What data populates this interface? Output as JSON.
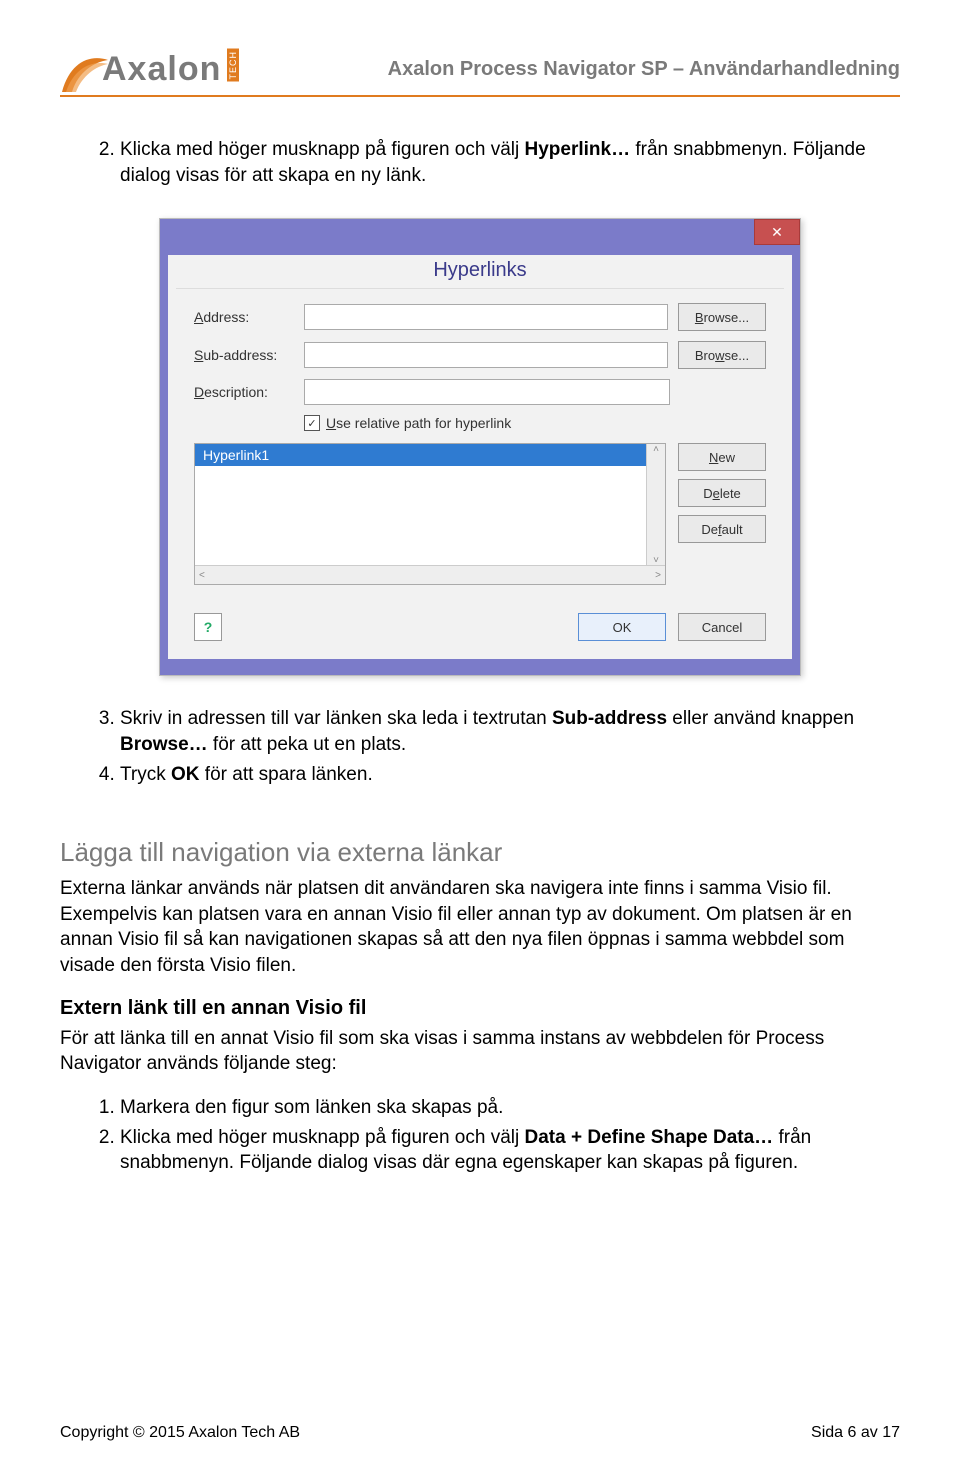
{
  "header": {
    "logo_text": "Axalon",
    "logo_tag": "TECH",
    "doc_title": "Axalon Process Navigator SP – Användarhandledning"
  },
  "list1": {
    "start": 2,
    "items": [
      {
        "prefix": "Klicka med höger musknapp på figuren och välj ",
        "bold": "Hyperlink…",
        "suffix": " från snabbmenyn. Följande dialog visas för att skapa en ny länk."
      }
    ]
  },
  "dialog": {
    "title": "Hyperlinks",
    "close": "✕",
    "address_label": "Address:",
    "sub_address_label": "Sub-address:",
    "description_label": "Description:",
    "browse": "Browse...",
    "checkbox_label": "Use relative path for hyperlink",
    "checkbox_checked": "✓",
    "list_item": "Hyperlink1",
    "btn_new": "New",
    "btn_delete": "Delete",
    "btn_default": "Default",
    "btn_ok": "OK",
    "btn_cancel": "Cancel",
    "help": "?"
  },
  "list2": {
    "start": 3,
    "items": [
      {
        "prefix": "Skriv in adressen till var länken ska leda i textrutan ",
        "bold1": "Sub-address",
        "mid": " eller använd knappen ",
        "bold2": "Browse…",
        "suffix": " för att peka ut en plats."
      },
      {
        "prefix": "Tryck ",
        "bold1": "OK",
        "suffix": " för att spara länken."
      }
    ]
  },
  "section": {
    "heading": "Lägga till navigation via externa länkar",
    "para1": "Externa länkar används när platsen dit användaren ska navigera inte finns i samma Visio fil. Exempelvis kan platsen vara en annan Visio fil eller annan typ av dokument. Om platsen är en annan Visio fil så kan navigationen skapas så att den nya filen öppnas i samma webbdel som visade den första Visio filen.",
    "sub_heading": "Extern länk till en annan Visio fil",
    "para2": "För att länka till en annat Visio fil som ska visas i samma instans av webbdelen för Process Navigator används följande steg:"
  },
  "list3": {
    "start": 1,
    "items": [
      {
        "text": "Markera den figur som länken ska skapas på."
      },
      {
        "prefix": "Klicka med höger musknapp på figuren och välj ",
        "bold": "Data + Define Shape Data…",
        "suffix": " från snabbmenyn. Följande dialog visas där egna egenskaper kan skapas på figuren."
      }
    ]
  },
  "footer": {
    "left": "Copyright © 2015 Axalon Tech AB",
    "right": "Sida 6 av 17"
  }
}
